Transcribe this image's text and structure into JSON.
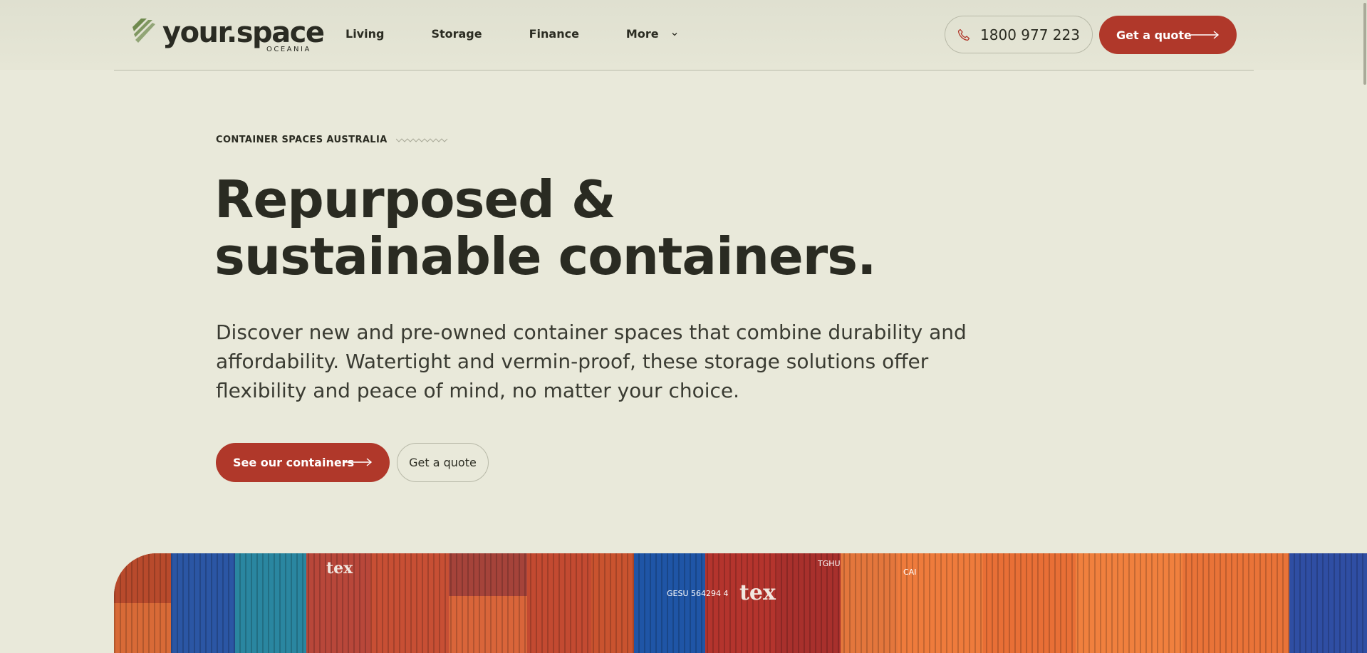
{
  "brand": {
    "name": "your.space",
    "sub": "OCEANIA",
    "accent": "#b0382a",
    "logo_green": "#6f8a4e"
  },
  "nav": {
    "items": [
      "Living",
      "Storage",
      "Finance",
      "More"
    ]
  },
  "header": {
    "phone": "1800 977 223",
    "quote_label": "Get a quote"
  },
  "hero": {
    "eyebrow": "CONTAINER SPACES AUSTRALIA",
    "headline": "Repurposed & sustainable containers.",
    "intro": "Discover new and pre-owned container spaces that combine durability and affordability. Watertight and vermin-proof, these storage solutions offer flexibility and peace of mind, no matter your choice.",
    "primary_cta": "See our containers",
    "secondary_cta": "Get a quote"
  },
  "image": {
    "labels": [
      "tex",
      "tex",
      "GESU 564294 4",
      "TGHU",
      "CAI"
    ]
  },
  "icons": [
    "phone-icon",
    "arrow-right-icon",
    "chevron-down-icon",
    "wave-icon",
    "logo-mark-icon"
  ]
}
